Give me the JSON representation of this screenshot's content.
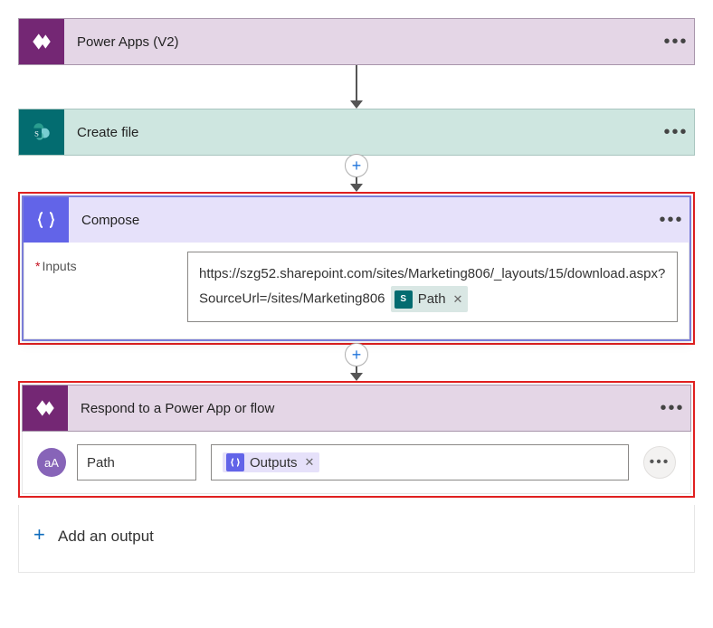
{
  "steps": {
    "trigger": {
      "title": "Power Apps (V2)"
    },
    "create": {
      "title": "Create file"
    },
    "compose": {
      "title": "Compose",
      "input_label": "Inputs",
      "input_value_prefix": "https://szg52.sharepoint.com/sites/Marketing806/_layouts/15/download.aspx?SourceUrl=/sites/Marketing806",
      "token_label": "Path"
    },
    "respond": {
      "title": "Respond to a Power App or flow",
      "output_name": "Path",
      "output_token": "Outputs",
      "add_label": "Add an output"
    }
  },
  "icons": {
    "powerapps_glyph": "",
    "sharepoint_glyph": "S",
    "compose_glyph": "{ }",
    "avatar_glyph": "aA"
  }
}
